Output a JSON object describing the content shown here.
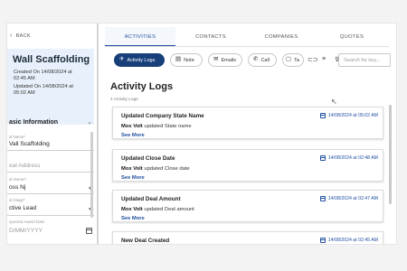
{
  "left": {
    "back_label": "BACK",
    "record": {
      "title": "Wall Scaffolding",
      "created_line1": "Created On 14/08/2024 at",
      "created_line2": "02:45 AM",
      "updated_line1": "Updated On 14/08/2024 at",
      "updated_line2": "05:02 AM"
    },
    "section_title": "asic Information",
    "fields": [
      {
        "label": "al Name*",
        "value": "Vall Scaffolding"
      },
      {
        "label": "",
        "value": "eal Address",
        "placeholder": true
      },
      {
        "label": "al Owner*",
        "value": "oss Nj"
      },
      {
        "label": "al Stage*",
        "value": "ctive Lead"
      },
      {
        "label": "xpected Award Date",
        "value": "D/MM/YYYY",
        "placeholder": true
      }
    ]
  },
  "tabs": [
    {
      "label": "ACTIVITIES",
      "active": true
    },
    {
      "label": "CONTACTS",
      "active": false
    },
    {
      "label": "COMPANIES",
      "active": false
    },
    {
      "label": "QUOTES",
      "active": false
    }
  ],
  "toolbar": {
    "chips": [
      {
        "label": "Activity Logs",
        "icon": "runner-icon",
        "active": true
      },
      {
        "label": "Note",
        "icon": "note-icon"
      },
      {
        "label": "Emails",
        "icon": "email-icon"
      },
      {
        "label": "Call",
        "icon": "phone-icon"
      },
      {
        "label": "Ta",
        "icon": "task-icon"
      }
    ],
    "search_placeholder": "Search for key..."
  },
  "activity": {
    "heading": "Activity Logs",
    "count_label": "4 Activity Logs",
    "items": [
      {
        "title": "Updated Company State Name",
        "actor": "Mox Volt",
        "text": "updated State name",
        "more": "See More",
        "timestamp": "14/08/2024 at 05:02 AM"
      },
      {
        "title": "Updated Close Date",
        "actor": "Mox Volt",
        "text": "updated Close date",
        "more": "See More",
        "timestamp": "14/08/2024 at 02:48 AM"
      },
      {
        "title": "Updated Deal Amount",
        "actor": "Mox Volt",
        "text": "updated Deal amount",
        "more": "See More",
        "timestamp": "14/08/2024 at 02:47 AM"
      },
      {
        "title": "New Deal Created",
        "actor": "",
        "text": "",
        "more": "",
        "timestamp": "14/08/2024 at 02:45 AM"
      }
    ]
  },
  "colors": {
    "accent": "#1f4fa0",
    "active_chip": "#173f7a",
    "card_bg": "#e8f1fb"
  }
}
